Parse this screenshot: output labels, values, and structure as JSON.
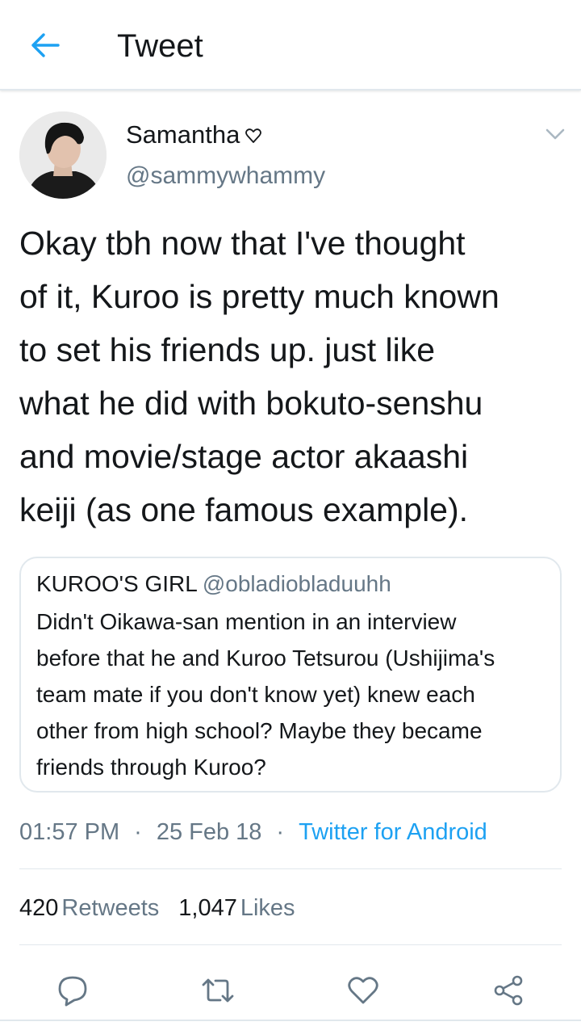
{
  "header": {
    "back_icon": "arrow-left-icon",
    "title": "Tweet",
    "accent_color": "#1da1f2"
  },
  "tweet": {
    "author": {
      "name": "Samantha",
      "badge_icon": "heart-outline-icon",
      "handle": "@sammywhammy",
      "avatar": "avatar-photo"
    },
    "caret_icon": "chevron-down-icon",
    "text": "Okay tbh now that I've thought\nof it, Kuroo is pretty much known\nto set his friends up. just like\nwhat he did with bokuto-senshu\nand movie/stage actor akaashi\nkeiji (as one famous example).",
    "quoted": {
      "name": "KUROO'S GIRL",
      "handle": "@obladiobladuuhh",
      "text": "Didn't Oikawa-san mention in an interview\nbefore that he and Kuroo Tetsurou (Ushijima's\nteam mate if you don't know yet) knew each\nother from high school? Maybe they became\nfriends through Kuroo?"
    },
    "time": "01:57 PM",
    "separator": "·",
    "date": "25 Feb 18",
    "source": "Twitter for Android",
    "stats": {
      "retweets_count": "420",
      "retweets_label": "Retweets",
      "likes_count": "1,047",
      "likes_label": "Likes"
    },
    "actions": {
      "reply_icon": "reply-icon",
      "retweet_icon": "retweet-icon",
      "like_icon": "heart-icon",
      "share_icon": "share-icon"
    }
  },
  "colors": {
    "text_primary": "#14171a",
    "text_secondary": "#657786",
    "link": "#1da1f2",
    "divider": "#e1e8ed"
  }
}
